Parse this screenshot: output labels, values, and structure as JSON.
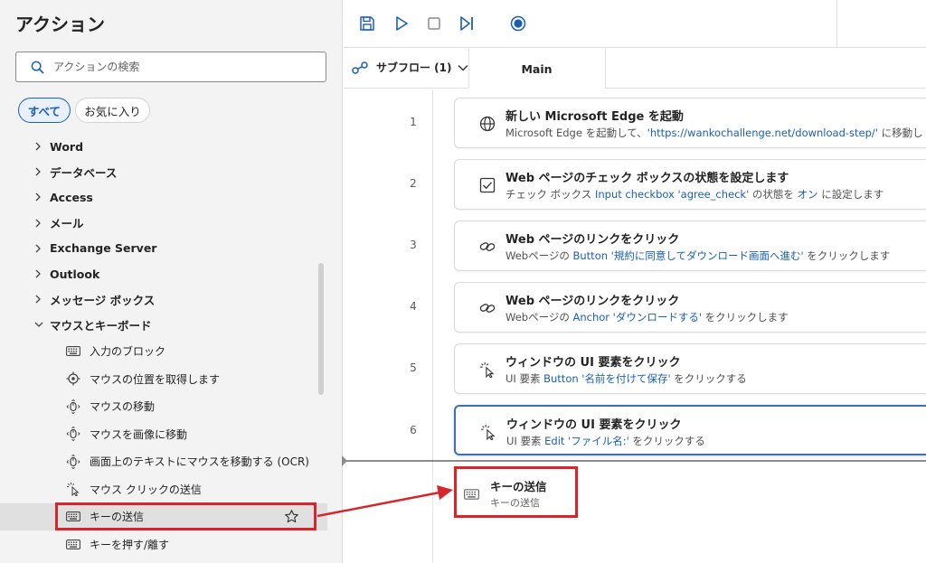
{
  "left": {
    "title": "アクション",
    "search_placeholder": "アクションの検索",
    "chip_all": "すべて",
    "chip_fav": "お気に入り",
    "categories": [
      "Word",
      "データベース",
      "Access",
      "メール",
      "Exchange Server",
      "Outlook",
      "メッセージ ボックス"
    ],
    "expanded_category": "マウスとキーボード",
    "items": [
      {
        "label": "入力のブロック",
        "icon": "keyboard-icon"
      },
      {
        "label": "マウスの位置を取得します",
        "icon": "crosshair-icon"
      },
      {
        "label": "マウスの移動",
        "icon": "mouse-move-icon"
      },
      {
        "label": "マウスを画像に移動",
        "icon": "mouse-move-icon"
      },
      {
        "label": "画面上のテキストにマウスを移動する (OCR)",
        "icon": "mouse-move-icon"
      },
      {
        "label": "マウス クリックの送信",
        "icon": "click-icon"
      },
      {
        "label": "キーの送信",
        "icon": "keyboard-icon"
      },
      {
        "label": "キーを押す/離す",
        "icon": "keyboard-icon"
      }
    ]
  },
  "toolbar": {
    "tabs_subflow": "サブフロー (1)",
    "tab_main": "Main"
  },
  "flow": {
    "steps": [
      {
        "num": "1",
        "title": "新しい Microsoft Edge を起動",
        "d1": "Microsoft Edge を起動して、",
        "d2": "'https://wankochallenge.net/download-step/'",
        "d3": " に移動し",
        "d4": "",
        "d5": ""
      },
      {
        "num": "2",
        "title": "Web ページのチェック ボックスの状態を設定します",
        "d1": "チェック ボックス ",
        "d2": "Input checkbox 'agree_check'",
        "d3": " の状態を ",
        "d4": "オン",
        "d5": " に設定します"
      },
      {
        "num": "3",
        "title": "Web ページのリンクをクリック",
        "d1": "Webページの ",
        "d2": "Button '規約に同意してダウンロード画面へ進む'",
        "d3": " をクリックします",
        "d4": "",
        "d5": ""
      },
      {
        "num": "4",
        "title": "Web ページのリンクをクリック",
        "d1": "Webページの ",
        "d2": "Anchor 'ダウンロードする'",
        "d3": " をクリックします",
        "d4": "",
        "d5": ""
      },
      {
        "num": "5",
        "title": "ウィンドウの UI 要素をクリック",
        "d1": "UI 要素 ",
        "d2": "Button '名前を付けて保存'",
        "d3": " をクリックする",
        "d4": "",
        "d5": ""
      },
      {
        "num": "6",
        "title": "ウィンドウの UI 要素をクリック",
        "d1": "UI 要素 ",
        "d2": "Edit 'ファイル名:'",
        "d3": " をクリックする",
        "d4": "",
        "d5": ""
      }
    ],
    "ghost": {
      "title": "キーの送信",
      "desc": "キーの送信"
    }
  },
  "colors": {
    "accent": "#1a5fb4",
    "highlight_red": "#d6262c",
    "selected_border": "#3b6fb6"
  }
}
